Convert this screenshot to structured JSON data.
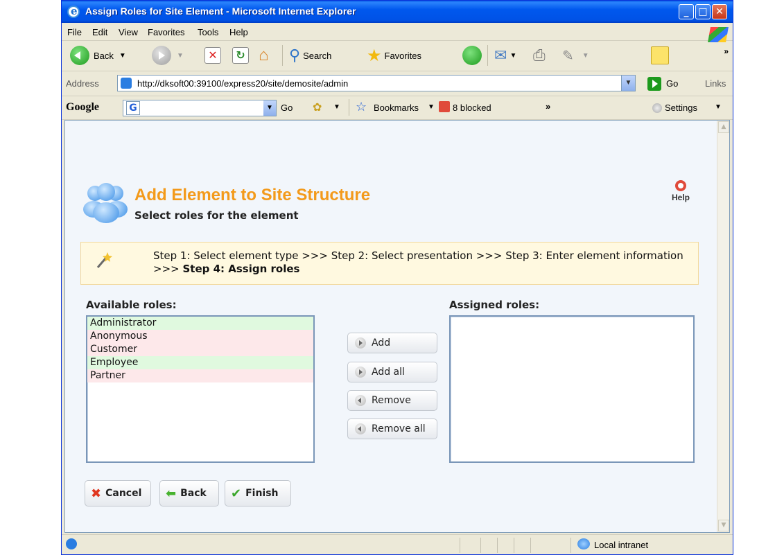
{
  "window": {
    "title": "Assign Roles for Site Element - Microsoft Internet Explorer",
    "controls": {
      "minimize": "_",
      "maximize": "□",
      "close": "✕"
    }
  },
  "menu": [
    "File",
    "Edit",
    "View",
    "Favorites",
    "Tools",
    "Help"
  ],
  "toolbar": {
    "back_label": "Back",
    "search_label": "Search",
    "favorites_label": "Favorites"
  },
  "address": {
    "label": "Address",
    "url": "http://dksoft00:39100/express20/site/demosite/admin",
    "go_label": "Go",
    "links_label": "Links"
  },
  "google_bar": {
    "logo": "Google",
    "go_label": "Go",
    "bookmarks_label": "Bookmarks",
    "blocked_label": "8 blocked",
    "settings_label": "Settings"
  },
  "page": {
    "heading": "Add Element to Site Structure",
    "subheading": "Select roles for the element",
    "help_label": "Help",
    "steps_prefix": "Step 1: Select element type >>> Step 2: Select presentation >>> Step 3: Enter element information >>> ",
    "steps_current": "Step 4: Assign roles",
    "available_label": "Available roles:",
    "assigned_label": "Assigned roles:",
    "available_roles": [
      {
        "name": "Administrator",
        "tone": "green"
      },
      {
        "name": "Anonymous",
        "tone": "pink"
      },
      {
        "name": "Customer",
        "tone": "pink"
      },
      {
        "name": "Employee",
        "tone": "green"
      },
      {
        "name": "Partner",
        "tone": "pink"
      }
    ],
    "assigned_roles": [],
    "buttons": {
      "add": "Add",
      "add_all": "Add all",
      "remove": "Remove",
      "remove_all": "Remove all",
      "cancel": "Cancel",
      "back": "Back",
      "finish": "Finish"
    }
  },
  "status": {
    "zone": "Local intranet"
  },
  "colors": {
    "heading": "#f39a1b",
    "titlebar": "#0058ee",
    "role_green": "#e0f9df",
    "role_pink": "#fde8ea"
  }
}
